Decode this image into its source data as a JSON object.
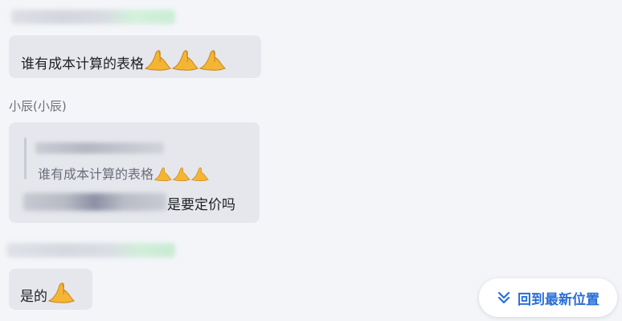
{
  "messages": [
    {
      "sender": "",
      "text": "谁有成本计算的表格",
      "emoji": [
        "pray-hands",
        "pray-hands",
        "pray-hands"
      ]
    },
    {
      "sender": "小辰(小辰)",
      "quote": {
        "text": "谁有成本计算的表格",
        "emoji": [
          "pray-hands",
          "pray-hands",
          "pray-hands"
        ]
      },
      "text": "是要定价吗"
    },
    {
      "sender": "",
      "text": "是的",
      "emoji": [
        "pray-hands"
      ]
    }
  ],
  "jump_button": {
    "label": "回到最新位置",
    "icon": "double-chevron-down-icon"
  },
  "colors": {
    "background": "#f4f5f9",
    "bubble": "#e5e7ec",
    "accent": "#2a6fd6",
    "muted_text": "#6b6f7b"
  }
}
